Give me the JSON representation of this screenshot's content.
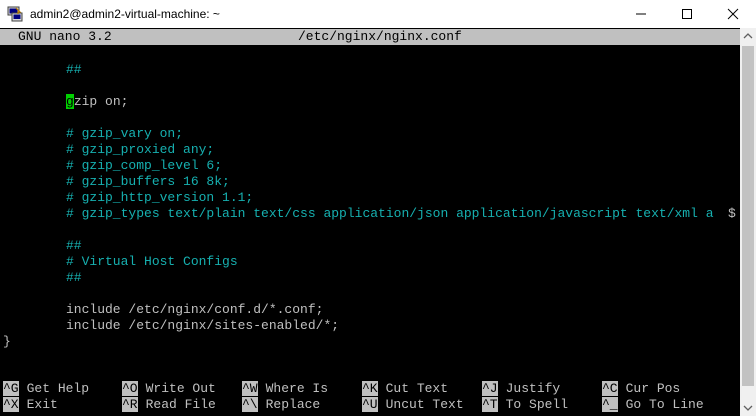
{
  "window": {
    "title": "admin2@admin2-virtual-machine: ~",
    "icon": "putty-terminal-icon",
    "controls": [
      "minimize-icon",
      "maximize-icon",
      "close-icon"
    ]
  },
  "nano": {
    "version_label": "GNU nano 3.2",
    "file_path": "/etc/nginx/nginx.conf"
  },
  "editor": {
    "line_hash_1": "##",
    "gzip_cursor_char": "g",
    "gzip_rest": "zip on;",
    "comment_vary": "# gzip_vary on;",
    "comment_proxied": "# gzip_proxied any;",
    "comment_comp_level": "# gzip_comp_level 6;",
    "comment_buffers": "# gzip_buffers 16 8k;",
    "comment_http_version": "# gzip_http_version 1.1;",
    "comment_types": "# gzip_types text/plain text/css application/json application/javascript text/xml a",
    "overflow_marker": "$",
    "vhost_hash_1": "##",
    "vhost_title": "# Virtual Host Configs",
    "vhost_hash_2": "##",
    "include_conf": "include /etc/nginx/conf.d/*.conf;",
    "include_sites": "include /etc/nginx/sites-enabled/*;",
    "closing_brace": "}"
  },
  "shortcuts": {
    "row1": [
      {
        "key": "^G",
        "label": "Get Help"
      },
      {
        "key": "^O",
        "label": "Write Out"
      },
      {
        "key": "^W",
        "label": "Where Is"
      },
      {
        "key": "^K",
        "label": "Cut Text"
      },
      {
        "key": "^J",
        "label": "Justify"
      },
      {
        "key": "^C",
        "label": "Cur Pos"
      }
    ],
    "row2": [
      {
        "key": "^X",
        "label": "Exit"
      },
      {
        "key": "^R",
        "label": "Read File"
      },
      {
        "key": "^\\",
        "label": "Replace"
      },
      {
        "key": "^U",
        "label": "Uncut Text"
      },
      {
        "key": "^T",
        "label": "To Spell"
      },
      {
        "key": "^_",
        "label": "Go To Line"
      }
    ]
  },
  "colors": {
    "terminal_bg": "#000000",
    "terminal_fg": "#c0c0c0",
    "comment": "#16b0b0",
    "cursor": "#00d000",
    "bar_bg": "#c0c0c0"
  }
}
